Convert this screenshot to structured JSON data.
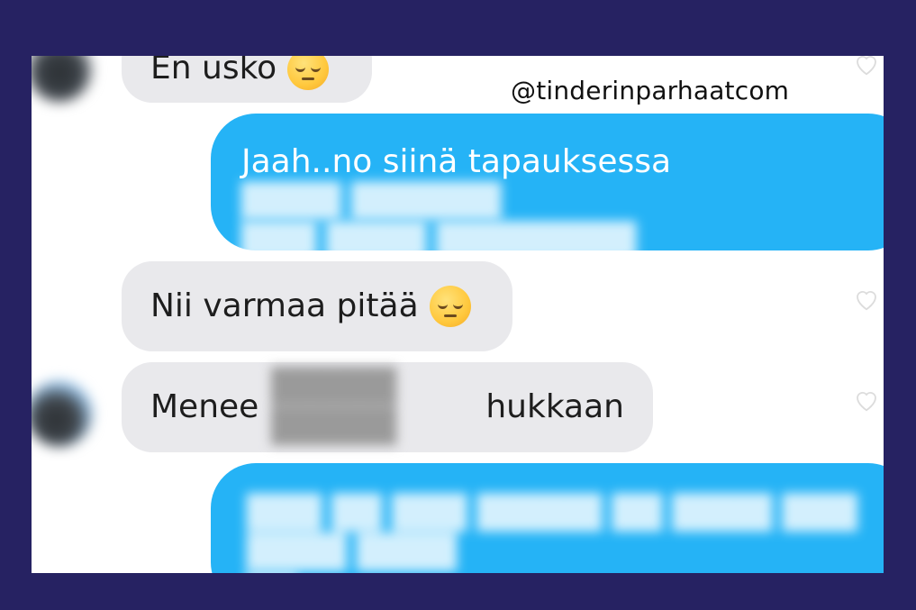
{
  "watermark": "@tinderinparhaatcom",
  "messages": [
    {
      "side": "incoming",
      "text": "En usko",
      "emoji": "pensive-face"
    },
    {
      "side": "outgoing",
      "text": "Jaah..no siinä tapauksessa",
      "redacted": true
    },
    {
      "side": "incoming",
      "text": "Nii varmaa pitää",
      "emoji": "pensive-face"
    },
    {
      "side": "incoming",
      "text_before": "Menee",
      "text_after": "hukkaan",
      "redacted": true
    },
    {
      "side": "outgoing",
      "redacted": true
    }
  ],
  "colors": {
    "outgoing": "#25b3f6",
    "incoming": "#e9e9ec",
    "frame": "#262262"
  },
  "icons": [
    "heart-icon",
    "pensive-face-emoji",
    "avatar"
  ]
}
